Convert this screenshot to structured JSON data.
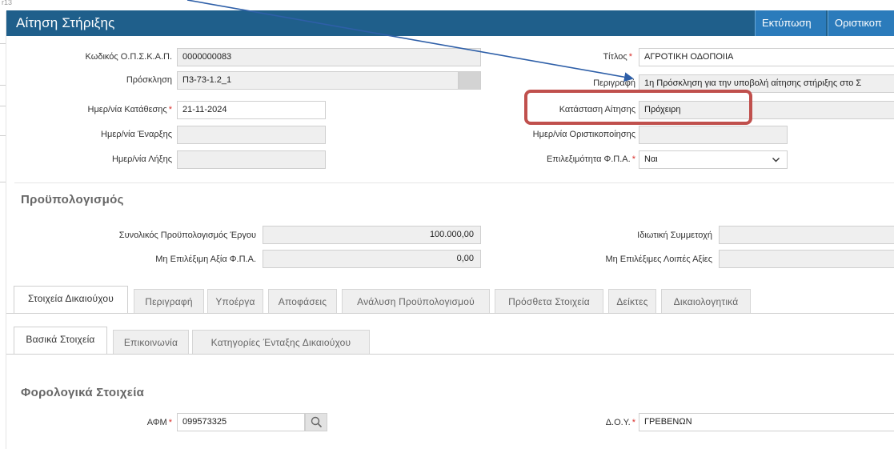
{
  "header": {
    "title": "Αίτηση Στήριξης",
    "print_label": "Εκτύπωση",
    "finalize_label": "Οριστικοπ"
  },
  "corner_text": "r13",
  "application": {
    "code_label": "Κωδικός Ο.Π.Σ.Κ.Α.Π.",
    "code_value": "0000000083",
    "call_label": "Πρόσκληση",
    "call_value": "Π3-73-1.2_1",
    "submission_date_label": "Ημερ/νία Κατάθεσης",
    "submission_date_value": "21-11-2024",
    "start_date_label": "Ημερ/νία Έναρξης",
    "start_date_value": "",
    "end_date_label": "Ημερ/νία Λήξης",
    "end_date_value": "",
    "title_label": "Τίτλος",
    "title_value": "ΑΓΡΟΤΙΚΗ ΟΔΟΠΟΙΙΑ",
    "description_label": "Περιγραφή",
    "description_value": "1η Πρόσκληση για την υποβολή αίτησης στήριξης στο Σ",
    "status_label": "Κατάσταση Αίτησης",
    "status_value": "Πρόχειρη",
    "finalize_date_label": "Ημερ/νία Οριστικοποίησης",
    "finalize_date_value": "",
    "vat_eligibility_label": "Επιλεξιμότητα Φ.Π.Α.",
    "vat_eligibility_value": "Ναι"
  },
  "budget": {
    "section_title": "Προϋπολογισμός",
    "total_label": "Συνολικός Προϋπολογισμός Έργου",
    "total_value": "100.000,00",
    "nonelig_vat_label": "Μη Επιλέξιμη Αξία Φ.Π.Α.",
    "nonelig_vat_value": "0,00",
    "private_label": "Ιδιωτική Συμμετοχή",
    "private_value": "",
    "other_nonelig_label": "Μη Επιλέξιμες Λοιπές Αξίες",
    "other_nonelig_value": ""
  },
  "main_tabs": [
    "Στοιχεία Δικαιούχου",
    "Περιγραφή",
    "Υποέργα",
    "Αποφάσεις",
    "Ανάλυση Προϋπολογισμού",
    "Πρόσθετα Στοιχεία",
    "Δείκτες",
    "Δικαιολογητικά"
  ],
  "sub_tabs": [
    "Βασικά Στοιχεία",
    "Επικοινωνία",
    "Κατηγορίες Ένταξης Δικαιούχου"
  ],
  "tax": {
    "section_title": "Φορολογικά Στοιχεία",
    "afm_label": "ΑΦΜ",
    "afm_value": "099573325",
    "doy_label": "Δ.Ο.Υ.",
    "doy_value": "ΓΡΕΒΕΝΩΝ"
  },
  "colors": {
    "header_bg": "#1f5f8b",
    "header_button_bg": "#2b7bbb",
    "required_marker": "#d9302c",
    "annotation_box": "#c0504d",
    "annotation_arrow": "#2e5fa8"
  }
}
